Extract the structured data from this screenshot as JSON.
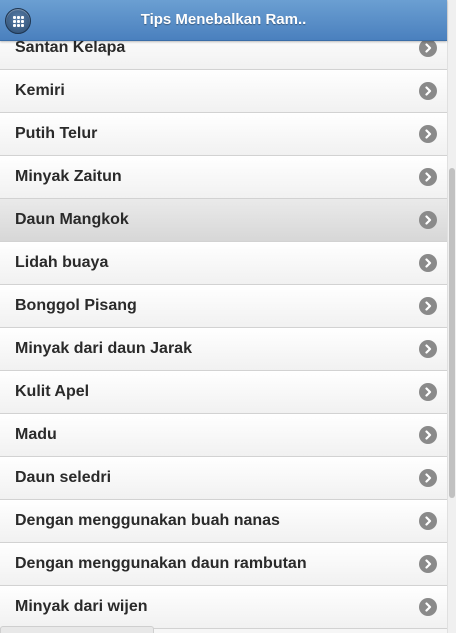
{
  "header": {
    "title": "Tips Menebalkan Ram.."
  },
  "list": {
    "items": [
      {
        "label": "Santan Kelapa"
      },
      {
        "label": "Kemiri"
      },
      {
        "label": "Putih Telur"
      },
      {
        "label": "Minyak Zaitun"
      },
      {
        "label": "Daun Mangkok"
      },
      {
        "label": "Lidah buaya"
      },
      {
        "label": "Bonggol Pisang"
      },
      {
        "label": "Minyak dari daun Jarak"
      },
      {
        "label": "Kulit Apel"
      },
      {
        "label": "Madu"
      },
      {
        "label": "Daun seledri"
      },
      {
        "label": "Dengan menggunakan buah nanas"
      },
      {
        "label": "Dengan menggunakan daun rambutan"
      },
      {
        "label": "Minyak dari wijen"
      }
    ],
    "active_index": 4
  },
  "colors": {
    "header_top": "#6b9fd2",
    "header_bottom": "#4a80be",
    "arrow": "#8a8a8a",
    "text": "#2a2a2a"
  },
  "icons": {
    "menu": "grid-menu-icon",
    "item_arrow": "chevron-right-circle-icon"
  }
}
